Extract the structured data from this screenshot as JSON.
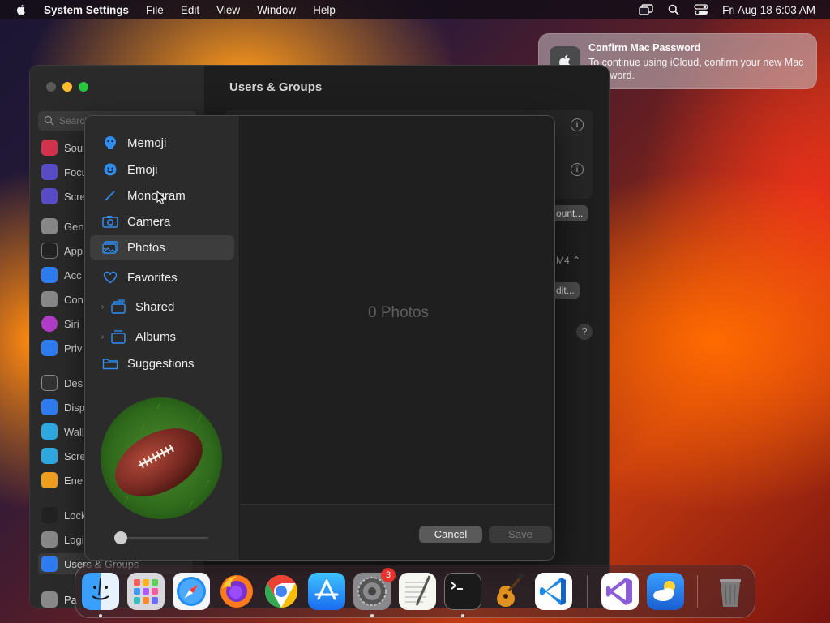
{
  "menubar": {
    "app_name": "System Settings",
    "items": [
      "File",
      "Edit",
      "View",
      "Window",
      "Help"
    ],
    "clock": "Fri Aug 18  6:03 AM"
  },
  "settings": {
    "title": "Users & Groups",
    "search_placeholder": "Search",
    "sidebar_items": [
      "Sou",
      "Focu",
      "Scre",
      "Gen",
      "App",
      "Acc",
      "Con",
      "Siri",
      "Priv",
      "Des",
      "Disp",
      "Wall",
      "Scre",
      "Ene",
      "Lock",
      "Logi",
      "Users & Groups",
      "Pa"
    ],
    "account_button_fragment": "ount...",
    "stepper_fragment": "M4",
    "edit_button_fragment": "dit...",
    "help_label": "?"
  },
  "picker": {
    "sources": [
      {
        "label": "Memoji",
        "icon": "memoji-icon"
      },
      {
        "label": "Emoji",
        "icon": "emoji-icon"
      },
      {
        "label": "Monogram",
        "icon": "monogram-icon"
      },
      {
        "label": "Camera",
        "icon": "camera-icon"
      },
      {
        "label": "Photos",
        "icon": "photos-icon"
      },
      {
        "label": "Favorites",
        "icon": "heart-icon"
      },
      {
        "label": "Shared",
        "icon": "shared-album-icon"
      },
      {
        "label": "Albums",
        "icon": "album-icon"
      },
      {
        "label": "Suggestions",
        "icon": "folder-icon"
      }
    ],
    "selected": "Photos",
    "empty_text": "0 Photos",
    "zoom_level": 0,
    "cancel_label": "Cancel",
    "save_label": "Save"
  },
  "notification": {
    "title": "Confirm Mac Password",
    "body": "To continue using iCloud, confirm your new Mac password.",
    "icon": "apple-logo-icon"
  },
  "dock": {
    "items": [
      {
        "name": "finder",
        "running": true
      },
      {
        "name": "launchpad",
        "running": false
      },
      {
        "name": "safari",
        "running": false
      },
      {
        "name": "firefox",
        "running": false
      },
      {
        "name": "chrome",
        "running": false
      },
      {
        "name": "app-store",
        "running": false
      },
      {
        "name": "system-settings",
        "running": true,
        "badge": "3"
      },
      {
        "name": "textedit",
        "running": false
      },
      {
        "name": "terminal",
        "running": true
      },
      {
        "name": "garageband",
        "running": false
      },
      {
        "name": "vscode",
        "running": false
      },
      {
        "name": "visual-studio",
        "running": false
      },
      {
        "name": "weather",
        "running": false
      },
      {
        "name": "trash",
        "running": false
      }
    ]
  },
  "colors": {
    "accent": "#2f8cf0",
    "traffic_red": "#ff5f57",
    "traffic_yellow": "#febc2e",
    "traffic_green": "#28c840",
    "badge_red": "#e5322b"
  }
}
